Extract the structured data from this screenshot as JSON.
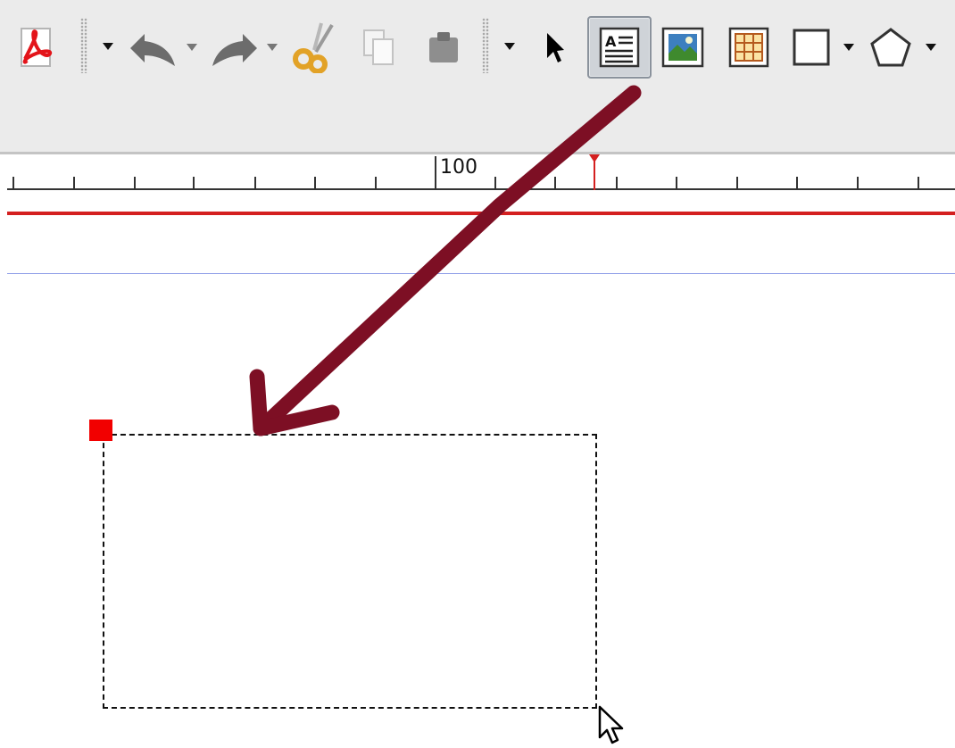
{
  "toolbar": {
    "buttons": [
      {
        "name": "export-pdf",
        "icon": "pdf-icon"
      },
      {
        "name": "undo",
        "icon": "undo-icon"
      },
      {
        "name": "redo",
        "icon": "redo-icon"
      },
      {
        "name": "cut",
        "icon": "scissors-icon"
      },
      {
        "name": "copy",
        "icon": "copy-icon"
      },
      {
        "name": "paste",
        "icon": "paste-icon"
      },
      {
        "name": "select-item",
        "icon": "pointer-icon"
      },
      {
        "name": "insert-text-frame",
        "icon": "text-frame-icon",
        "active": true
      },
      {
        "name": "insert-image-frame",
        "icon": "image-frame-icon"
      },
      {
        "name": "insert-table",
        "icon": "table-icon"
      },
      {
        "name": "insert-shape",
        "icon": "rectangle-icon"
      },
      {
        "name": "insert-polygon",
        "icon": "polygon-icon"
      }
    ]
  },
  "ruler": {
    "label": "100"
  },
  "colors": {
    "annotation_arrow": "#7d0f24",
    "margin_guide": "#d42020",
    "baseline_guide": "#8f9ee8",
    "anchor_handle": "#f20000",
    "active_button_bg": "#cfd3d8"
  }
}
